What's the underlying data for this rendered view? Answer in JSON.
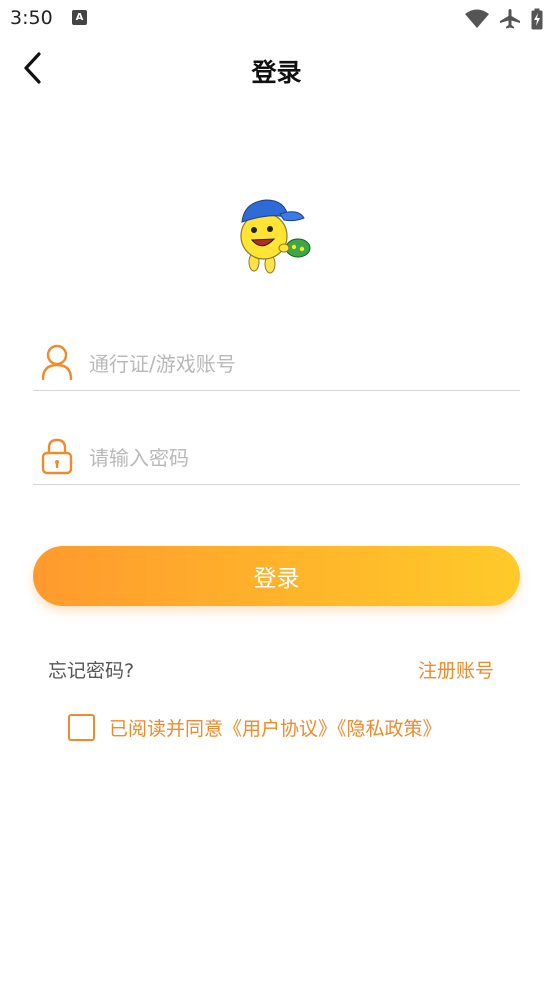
{
  "status_bar": {
    "time": "3:50",
    "notification_icon_letter": "A",
    "icons": [
      "wifi-icon",
      "airplane-icon",
      "battery-icon"
    ]
  },
  "header": {
    "title": "登录",
    "back_icon": "chevron-left-icon"
  },
  "form": {
    "account_placeholder": "通行证/游戏账号",
    "account_value": "",
    "password_placeholder": "请输入密码",
    "password_value": "",
    "account_icon": "user-icon",
    "password_icon": "lock-icon"
  },
  "login_button": "登录",
  "links": {
    "forgot_password": "忘记密码?",
    "register": "注册账号"
  },
  "agreement": {
    "checked": false,
    "prefix": "已阅读并同意",
    "user_agreement": "《用户协议》",
    "privacy_policy": "《隐私政策》"
  },
  "colors": {
    "accent": "#f08a2c",
    "button_gradient_start": "#ff9a2e",
    "button_gradient_end": "#ffca2a",
    "placeholder": "#b9b9b9"
  }
}
